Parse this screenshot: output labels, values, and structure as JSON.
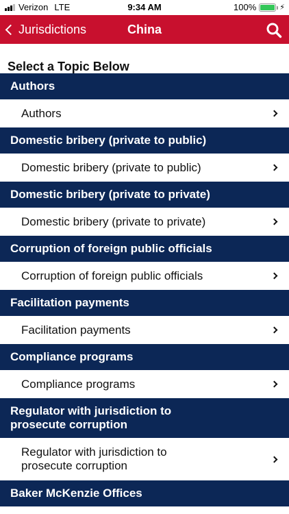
{
  "status_bar": {
    "carrier": "Verizon",
    "network": "LTE",
    "time": "9:34 AM",
    "battery_percent": "100%",
    "battery_level": 1.0,
    "battery_color": "#34c759"
  },
  "nav": {
    "back_label": "Jurisdictions",
    "title": "China",
    "bar_color": "#c8102e"
  },
  "section_heading": "Select a Topic Below",
  "header_color": "#0c2756",
  "topics": [
    {
      "header": "Authors",
      "item": "Authors"
    },
    {
      "header": "Domestic bribery (private to public)",
      "item": "Domestic bribery (private to public)"
    },
    {
      "header": "Domestic bribery (private to private)",
      "item": "Domestic bribery (private to private)"
    },
    {
      "header": "Corruption of foreign public officials",
      "item": "Corruption of foreign public officials"
    },
    {
      "header": "Facilitation payments",
      "item": "Facilitation payments"
    },
    {
      "header": "Compliance programs",
      "item": "Compliance programs"
    },
    {
      "header": "Regulator with jurisdiction to\nprosecute corruption",
      "item": "Regulator with jurisdiction to\nprosecute corruption"
    },
    {
      "header": "Baker McKenzie Offices"
    }
  ]
}
